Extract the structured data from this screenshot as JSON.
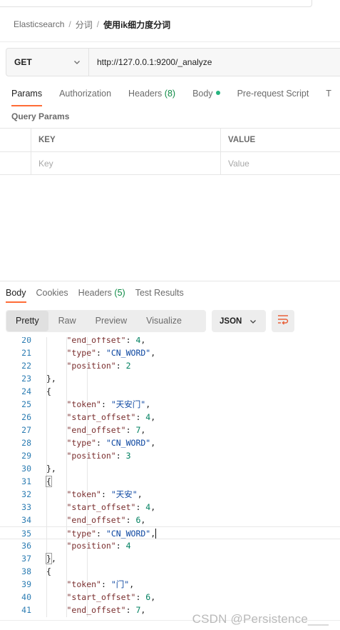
{
  "breadcrumb": {
    "items": [
      "Elasticsearch",
      "分词"
    ],
    "separator": "/",
    "current": "使用ik细力度分词"
  },
  "request": {
    "method": "GET",
    "url": "http://127.0.0.1:9200/_analyze",
    "tabs": [
      {
        "label": "Params",
        "active": true
      },
      {
        "label": "Authorization"
      },
      {
        "label": "Headers",
        "count": "(8)"
      },
      {
        "label": "Body",
        "dot": true
      },
      {
        "label": "Pre-request Script"
      },
      {
        "label": "T"
      }
    ],
    "query_params_title": "Query Params",
    "table": {
      "headers": [
        "KEY",
        "VALUE"
      ],
      "placeholders": [
        "Key",
        "Value"
      ]
    }
  },
  "response": {
    "tabs": [
      {
        "label": "Body",
        "active": true
      },
      {
        "label": "Cookies"
      },
      {
        "label": "Headers",
        "count": "(5)"
      },
      {
        "label": "Test Results"
      }
    ],
    "view_tabs": [
      "Pretty",
      "Raw",
      "Preview",
      "Visualize"
    ],
    "active_view": "Pretty",
    "format": "JSON"
  },
  "editor": {
    "lines": [
      {
        "n": "20",
        "indent": 3,
        "parts": [
          [
            "k",
            "\"end_offset\""
          ],
          [
            "p",
            ": "
          ],
          [
            "n",
            "4"
          ],
          [
            "p",
            ","
          ]
        ]
      },
      {
        "n": "21",
        "indent": 3,
        "parts": [
          [
            "k",
            "\"type\""
          ],
          [
            "p",
            ": "
          ],
          [
            "s",
            "\"CN_WORD\""
          ],
          [
            "p",
            ","
          ]
        ]
      },
      {
        "n": "22",
        "indent": 3,
        "parts": [
          [
            "k",
            "\"position\""
          ],
          [
            "p",
            ": "
          ],
          [
            "n",
            "2"
          ]
        ]
      },
      {
        "n": "23",
        "indent": 2,
        "parts": [
          [
            "p",
            "},"
          ]
        ]
      },
      {
        "n": "24",
        "indent": 2,
        "parts": [
          [
            "p",
            "{"
          ]
        ]
      },
      {
        "n": "25",
        "indent": 3,
        "parts": [
          [
            "k",
            "\"token\""
          ],
          [
            "p",
            ": "
          ],
          [
            "s",
            "\"天安门\""
          ],
          [
            "p",
            ","
          ]
        ]
      },
      {
        "n": "26",
        "indent": 3,
        "parts": [
          [
            "k",
            "\"start_offset\""
          ],
          [
            "p",
            ": "
          ],
          [
            "n",
            "4"
          ],
          [
            "p",
            ","
          ]
        ]
      },
      {
        "n": "27",
        "indent": 3,
        "parts": [
          [
            "k",
            "\"end_offset\""
          ],
          [
            "p",
            ": "
          ],
          [
            "n",
            "7"
          ],
          [
            "p",
            ","
          ]
        ]
      },
      {
        "n": "28",
        "indent": 3,
        "parts": [
          [
            "k",
            "\"type\""
          ],
          [
            "p",
            ": "
          ],
          [
            "s",
            "\"CN_WORD\""
          ],
          [
            "p",
            ","
          ]
        ]
      },
      {
        "n": "29",
        "indent": 3,
        "parts": [
          [
            "k",
            "\"position\""
          ],
          [
            "p",
            ": "
          ],
          [
            "n",
            "3"
          ]
        ]
      },
      {
        "n": "30",
        "indent": 2,
        "parts": [
          [
            "p",
            "},"
          ]
        ]
      },
      {
        "n": "31",
        "indent": 2,
        "parts": [
          [
            "b",
            "{"
          ]
        ]
      },
      {
        "n": "32",
        "indent": 3,
        "parts": [
          [
            "k",
            "\"token\""
          ],
          [
            "p",
            ": "
          ],
          [
            "s",
            "\"天安\""
          ],
          [
            "p",
            ","
          ]
        ]
      },
      {
        "n": "33",
        "indent": 3,
        "parts": [
          [
            "k",
            "\"start_offset\""
          ],
          [
            "p",
            ": "
          ],
          [
            "n",
            "4"
          ],
          [
            "p",
            ","
          ]
        ]
      },
      {
        "n": "34",
        "indent": 3,
        "parts": [
          [
            "k",
            "\"end_offset\""
          ],
          [
            "p",
            ": "
          ],
          [
            "n",
            "6"
          ],
          [
            "p",
            ","
          ]
        ]
      },
      {
        "n": "35",
        "indent": 3,
        "current": true,
        "parts": [
          [
            "k",
            "\"type\""
          ],
          [
            "p",
            ": "
          ],
          [
            "s",
            "\"CN_WORD\""
          ],
          [
            "p",
            ","
          ],
          [
            "c",
            ""
          ]
        ]
      },
      {
        "n": "36",
        "indent": 3,
        "parts": [
          [
            "k",
            "\"position\""
          ],
          [
            "p",
            ": "
          ],
          [
            "n",
            "4"
          ]
        ]
      },
      {
        "n": "37",
        "indent": 2,
        "parts": [
          [
            "b",
            "}"
          ],
          [
            "p",
            ","
          ]
        ]
      },
      {
        "n": "38",
        "indent": 2,
        "parts": [
          [
            "p",
            "{"
          ]
        ]
      },
      {
        "n": "39",
        "indent": 3,
        "parts": [
          [
            "k",
            "\"token\""
          ],
          [
            "p",
            ": "
          ],
          [
            "s",
            "\"门\""
          ],
          [
            "p",
            ","
          ]
        ]
      },
      {
        "n": "40",
        "indent": 3,
        "parts": [
          [
            "k",
            "\"start_offset\""
          ],
          [
            "p",
            ": "
          ],
          [
            "n",
            "6"
          ],
          [
            "p",
            ","
          ]
        ]
      },
      {
        "n": "41",
        "indent": 3,
        "parts": [
          [
            "k",
            "\"end_offset\""
          ],
          [
            "p",
            ": "
          ],
          [
            "n",
            "7"
          ],
          [
            "p",
            ","
          ]
        ]
      }
    ]
  },
  "watermark": "CSDN @Persistence___",
  "icons": {
    "method_dropdown": "chevron-down-icon",
    "format_dropdown": "chevron-down-icon",
    "wrap": "wrap-lines-icon"
  },
  "colors": {
    "accent": "#ff6c37",
    "count": "#0d8a45",
    "key": "#7a2e2e",
    "string": "#0d47a1",
    "number": "#008060",
    "line_number": "#2d7db3"
  }
}
